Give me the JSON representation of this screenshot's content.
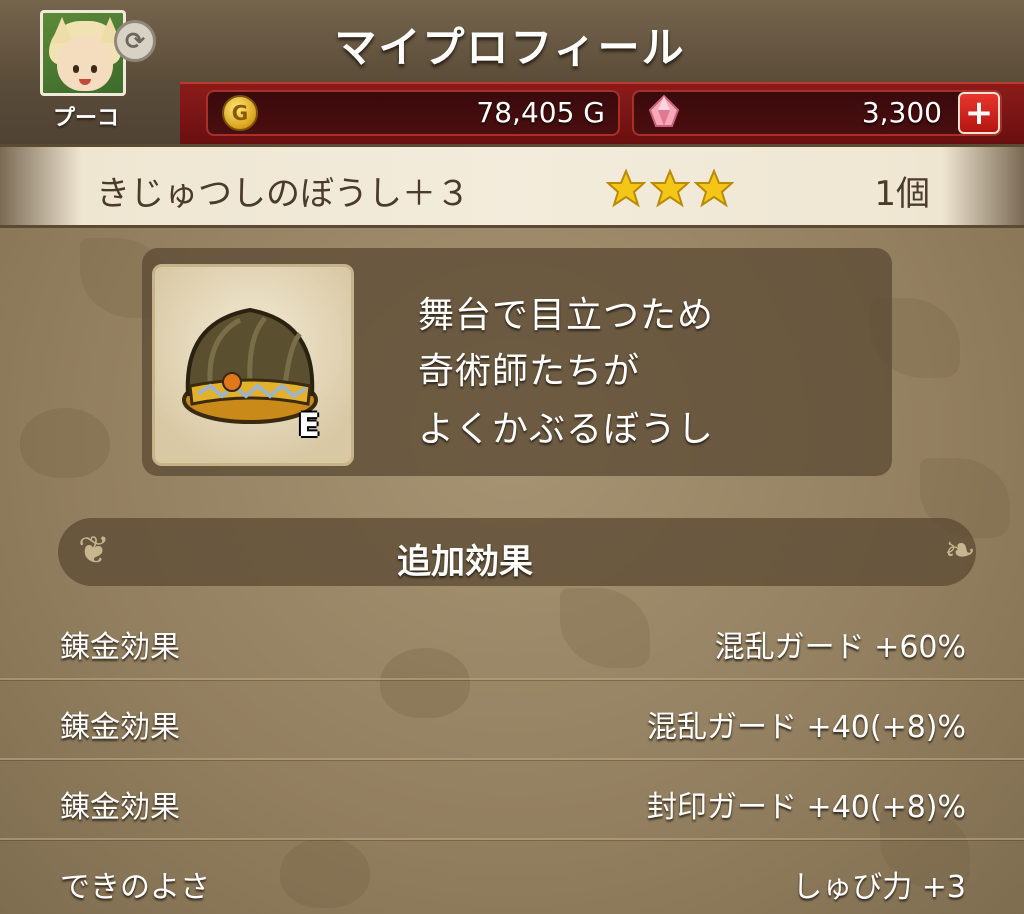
{
  "header": {
    "title": "マイプロフィール",
    "avatar_name": "プーコ",
    "gold": "78,405 G",
    "gems": "3,300",
    "coin_symbol": "G",
    "plus_symbol": "+"
  },
  "item": {
    "name": "きじゅつしのぼうし＋３",
    "rarity_stars": 3,
    "count": "1個",
    "equipped_badge": "E",
    "description": [
      "舞台で目立つため",
      "奇術師たちが",
      "よくかぶるぼうし"
    ]
  },
  "effects": {
    "section_title": "追加効果",
    "rows": [
      {
        "label": "錬金効果",
        "value": "混乱ガード +60%"
      },
      {
        "label": "錬金効果",
        "value": "混乱ガード +40(+8)%"
      },
      {
        "label": "錬金効果",
        "value": "封印ガード +40(+8)%"
      },
      {
        "label": "できのよさ",
        "value": "しゅび力 +3"
      }
    ]
  },
  "colors": {
    "accent_red": "#8c1b1b",
    "star_gold": "#f5c518",
    "panel_brown": "#5c4c34",
    "text_dark": "#4a3b2a"
  },
  "icons": [
    "swap-icon",
    "gold-coin-icon",
    "gem-icon",
    "plus-icon",
    "star-icon",
    "hat-icon"
  ]
}
